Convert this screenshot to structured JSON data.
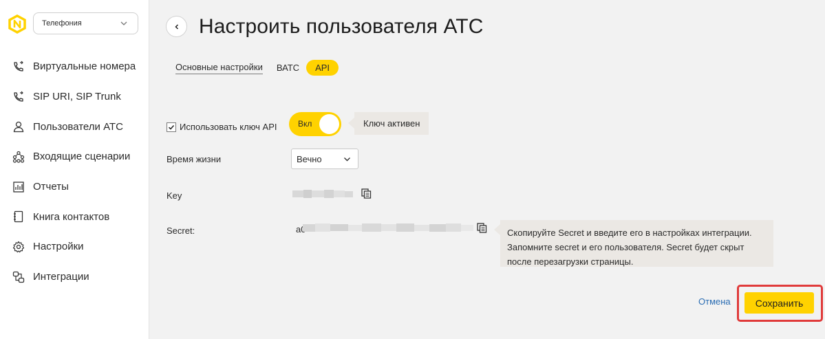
{
  "sidebar": {
    "product_select": "Телефония",
    "items": [
      {
        "label": "Виртуальные номера",
        "icon": "phone-forward-icon"
      },
      {
        "label": "SIP URI, SIP Trunk",
        "icon": "phone-forward-icon"
      },
      {
        "label": "Пользователи АТС",
        "icon": "user-icon"
      },
      {
        "label": "Входящие сценарии",
        "icon": "flow-scheme-icon"
      },
      {
        "label": "Отчеты",
        "icon": "report-chart-icon"
      },
      {
        "label": "Книга контактов",
        "icon": "contact-book-icon"
      },
      {
        "label": "Настройки",
        "icon": "gear-icon"
      },
      {
        "label": "Интеграции",
        "icon": "integrations-icon"
      }
    ]
  },
  "header": {
    "title": "Настроить пользователя АТС"
  },
  "tabs": [
    {
      "label": "Основные настройки",
      "active": false
    },
    {
      "label": "ВАТС",
      "active": false
    },
    {
      "label": "API",
      "active": true
    }
  ],
  "form": {
    "use_api_key_label": "Использовать ключ API",
    "use_api_key_checked": true,
    "toggle_label": "Вкл",
    "toggle_on": true,
    "toggle_hint": "Ключ активен",
    "lifetime_label": "Время жизни",
    "lifetime_value": "Вечно",
    "key_label": "Key",
    "secret_label": "Secret:",
    "secret_prefix": "a0",
    "secret_hint": "Скопируйте Secret и введите его в настройках интеграции. Запомните secret и его пользователя. Secret будет скрыт после перезагрузки страницы."
  },
  "actions": {
    "cancel_label": "Отмена",
    "save_label": "Сохранить"
  },
  "colors": {
    "accent": "#ffd200",
    "link": "#2b6db3",
    "highlight": "#e03a3a"
  }
}
